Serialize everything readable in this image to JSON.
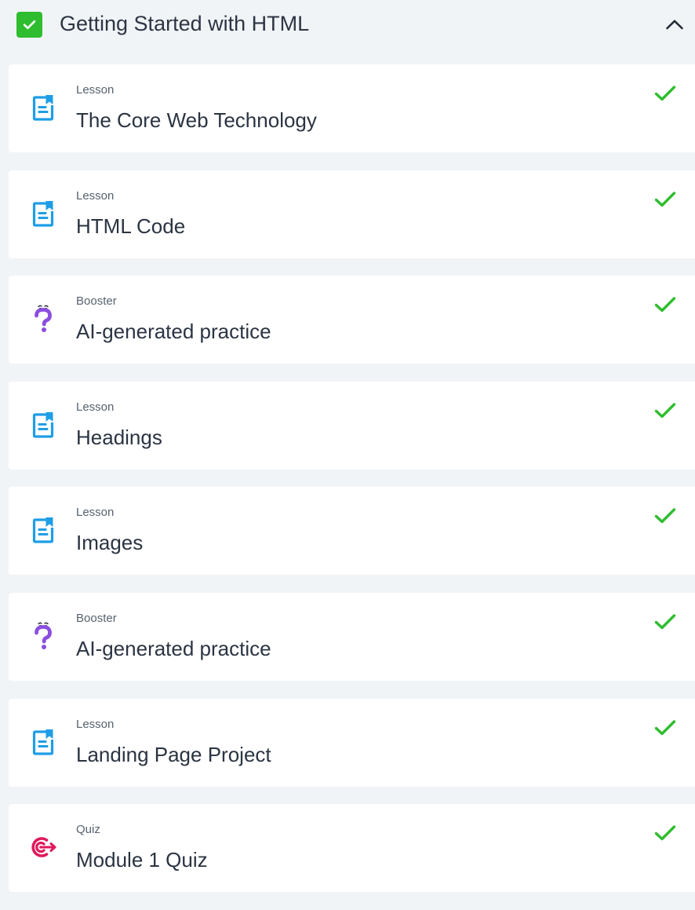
{
  "module": {
    "title": "Getting Started with HTML",
    "completed": true,
    "status_icon": "checkbox-checked-icon",
    "collapse_icon": "chevron-up-icon"
  },
  "colors": {
    "page_bg": "#f1f4f7",
    "card_bg": "#ffffff",
    "check_green": "#2ebd2e",
    "lesson_blue": "#1e9ee6",
    "booster_purple": "#8a4ee0",
    "quiz_pink": "#e0195c"
  },
  "items": [
    {
      "type": "Lesson",
      "title": "The Core Web Technology",
      "icon": "lesson-document-icon",
      "completed": true
    },
    {
      "type": "Lesson",
      "title": "HTML Code",
      "icon": "lesson-document-icon",
      "completed": true
    },
    {
      "type": "Booster",
      "title": "AI-generated practice",
      "icon": "question-mark-face-icon",
      "completed": true
    },
    {
      "type": "Lesson",
      "title": "Headings",
      "icon": "lesson-document-icon",
      "completed": true
    },
    {
      "type": "Lesson",
      "title": "Images",
      "icon": "lesson-document-icon",
      "completed": true
    },
    {
      "type": "Booster",
      "title": "AI-generated practice",
      "icon": "question-mark-face-icon",
      "completed": true
    },
    {
      "type": "Lesson",
      "title": "Landing Page Project",
      "icon": "lesson-document-icon",
      "completed": true
    },
    {
      "type": "Quiz",
      "title": "Module 1 Quiz",
      "icon": "quiz-target-icon",
      "completed": true
    }
  ]
}
